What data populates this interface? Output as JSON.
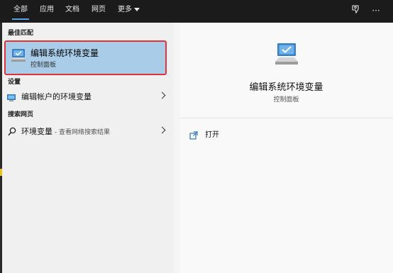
{
  "tabs": [
    {
      "label": "全部",
      "active": true
    },
    {
      "label": "应用",
      "active": false
    },
    {
      "label": "文档",
      "active": false
    },
    {
      "label": "网页",
      "active": false
    }
  ],
  "more_label": "更多",
  "sections": {
    "best_match": "最佳匹配",
    "settings": "设置",
    "web_search": "搜索网页"
  },
  "best_match": {
    "title": "编辑系统环境变量",
    "subtitle": "控制面板",
    "icon": "control-panel-icon"
  },
  "settings_item": {
    "label": "编辑帐户的环境变量",
    "icon": "settings-monitor-icon"
  },
  "web_item": {
    "label": "环境变量",
    "sub": " - 查看网络搜索结果",
    "icon": "search-icon"
  },
  "detail": {
    "title": "编辑系统环境变量",
    "subtitle": "控制面板",
    "action_open": "打开",
    "icon": "control-panel-icon"
  },
  "colors": {
    "highlight": "#a9cde9",
    "red_box": "#e0333a",
    "topbar": "#1b1b1b",
    "accent": "#5aa0e6"
  }
}
